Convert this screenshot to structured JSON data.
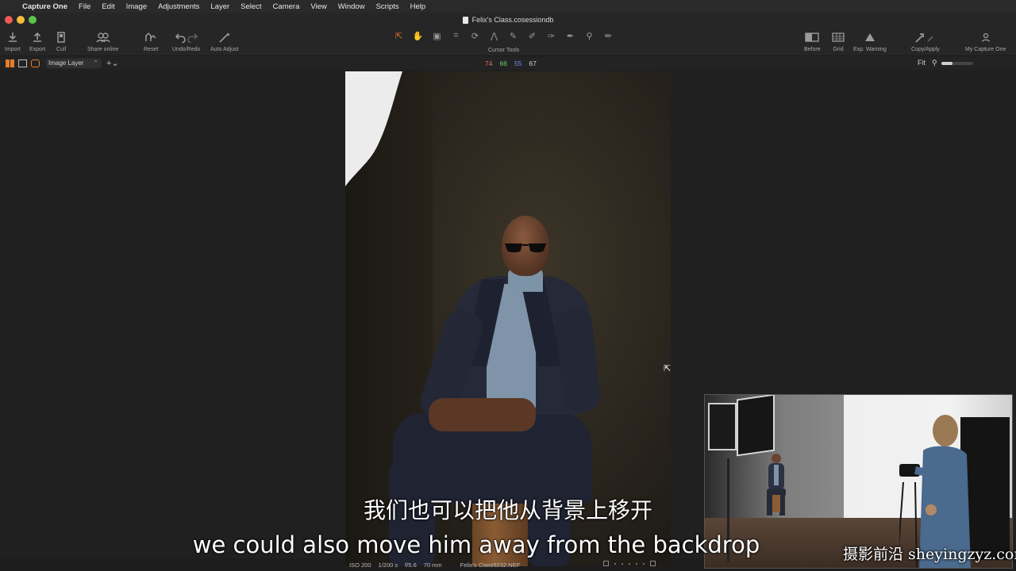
{
  "menubar": {
    "app_name": "Capture One",
    "items": [
      "File",
      "Edit",
      "Image",
      "Adjustments",
      "Layer",
      "Select",
      "Camera",
      "View",
      "Window",
      "Scripts",
      "Help"
    ]
  },
  "window": {
    "title": "Felix's Class.cosessiondb"
  },
  "toolbar": {
    "import": "Import",
    "export": "Export",
    "cull": "Cull",
    "share": "Share online",
    "reset": "Reset",
    "undo_redo": "Undo/Redo",
    "auto_adjust": "Auto Adjust",
    "cursor_tools": "Cursor Tools",
    "before": "Before",
    "grid": "Grid",
    "exp_warning": "Exp. Warning",
    "copy_apply": "Copy/Apply",
    "my_capture_one": "My Capture One"
  },
  "viewer_bar": {
    "layer_select": "Image Layer",
    "rgb": {
      "r": "74",
      "g": "66",
      "b": "55",
      "l": "67"
    },
    "zoom": "Fit"
  },
  "subtitles": {
    "chinese": "我们也可以把他从背景上移开",
    "english": "we could also move him away from the backdrop"
  },
  "status": {
    "iso": "ISO 200",
    "shutter": "1/200 s",
    "aperture": "f/5.6",
    "focal": "70 mm",
    "filename": "Felix's Class5232.NEF"
  },
  "watermark": "摄影前沿 sheyingzyz.com",
  "icons": [
    "apple-icon",
    "import-icon",
    "export-icon",
    "cull-icon",
    "share-icon",
    "reset-icon",
    "undo-icon",
    "redo-icon",
    "auto-adjust-icon",
    "before-icon",
    "grid-icon",
    "warning-icon",
    "copy-apply-icon",
    "user-icon"
  ],
  "colors": {
    "accent": "#e57d2b",
    "red": "#e36c6c",
    "green": "#6fd06f",
    "blue": "#6f8fe3"
  }
}
